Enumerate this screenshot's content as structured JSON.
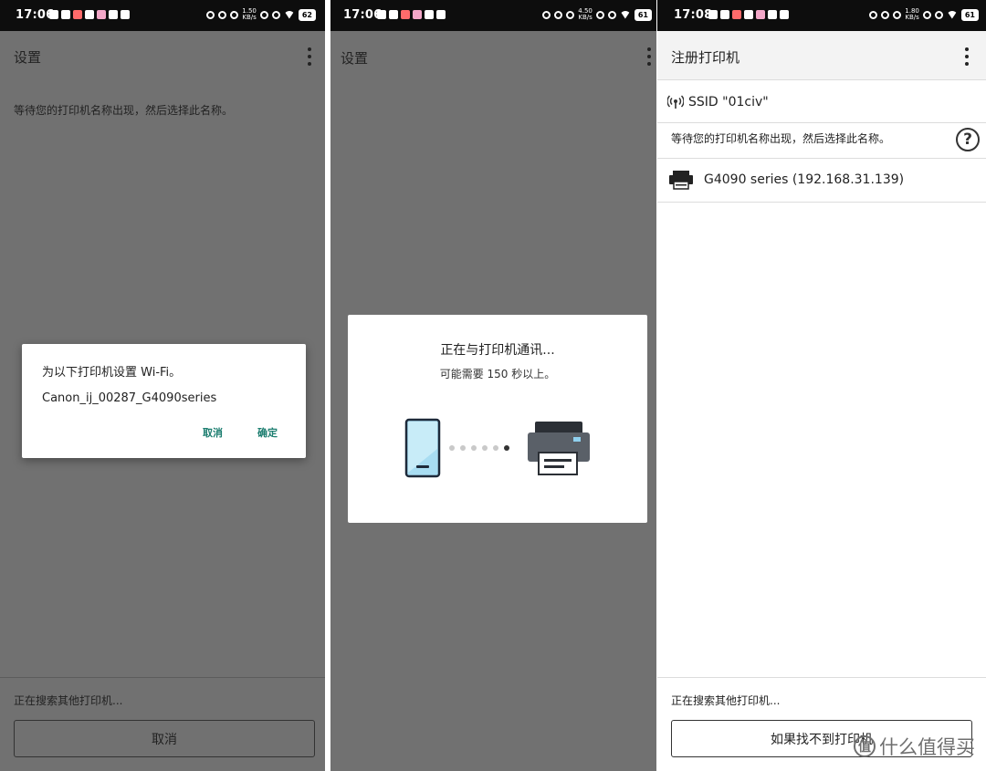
{
  "panels": [
    {
      "status": {
        "time": "17:06",
        "speed_top": "1.50",
        "speed_bottom": "KB/s",
        "battery": "62"
      },
      "appbar": {
        "title": "设置"
      },
      "instruction": "等待您的打印机名称出现，然后选择此名称。",
      "dialog": {
        "title": "为以下打印机设置 Wi-Fi。",
        "printer_name": "Canon_ij_00287_G4090series",
        "cancel_label": "取消",
        "ok_label": "确定"
      },
      "searching_text": "正在搜索其他打印机...",
      "cancel_button_label": "取消"
    },
    {
      "status": {
        "time": "17:06",
        "speed_top": "4.50",
        "speed_bottom": "KB/s",
        "battery": "61"
      },
      "appbar": {
        "title": "设置"
      },
      "dialog": {
        "title": "正在与打印机通讯...",
        "subtitle": "可能需要 150 秒以上。"
      }
    },
    {
      "status": {
        "time": "17:08",
        "speed_top": "1.80",
        "speed_bottom": "KB/s",
        "battery": "61"
      },
      "appbar": {
        "title": "注册打印机"
      },
      "ssid": "SSID \"01civ\"",
      "instruction": "等待您的打印机名称出现，然后选择此名称。",
      "help_label": "?",
      "printer": "G4090 series (192.168.31.139)",
      "searching_text": "正在搜索其他打印机...",
      "not_found_button_label": "如果找不到打印机"
    }
  ],
  "watermark": {
    "logo": "值",
    "text": "什么值得买"
  },
  "colors": {
    "accent": "#1b7d6f",
    "scrim": "#717171",
    "phone_screen": "#a8ddf2",
    "printer_body": "#5a6068"
  }
}
